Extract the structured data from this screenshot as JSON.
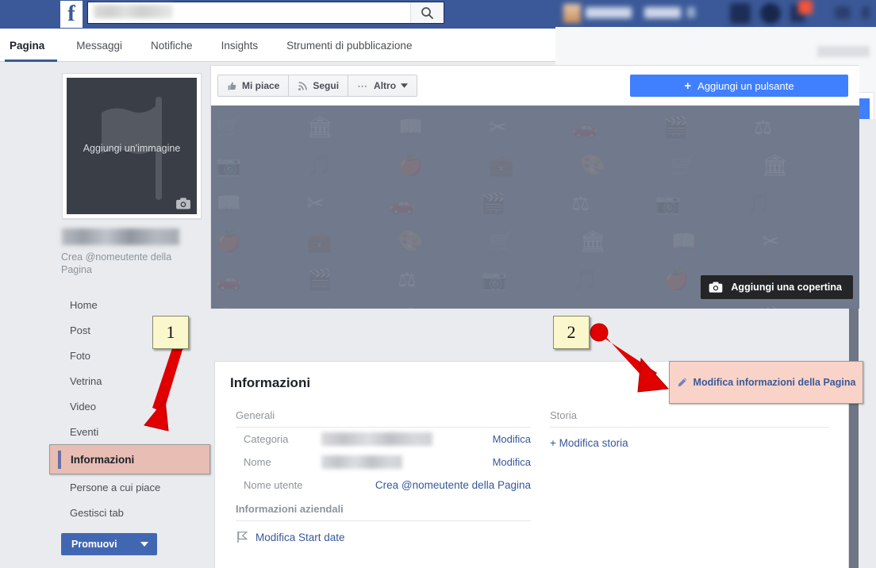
{
  "topbar": {
    "logo": "f",
    "search_placeholder": "",
    "search_value": "",
    "search_icon": "search-icon"
  },
  "tabs": [
    {
      "label": "Pagina",
      "active": true
    },
    {
      "label": "Messaggi",
      "active": false
    },
    {
      "label": "Notifiche",
      "active": false
    },
    {
      "label": "Insights",
      "active": false
    },
    {
      "label": "Strumenti di pubblicazione",
      "active": false
    }
  ],
  "action_bar": {
    "like_label": "Mi piace",
    "follow_label": "Segui",
    "more_label": "Altro",
    "add_button_label": "Aggiungi un pulsante",
    "add_button_plus": "+"
  },
  "cover": {
    "add_cover_label": "Aggiungi una copertina",
    "camera_icon": "camera-icon"
  },
  "profile_picture": {
    "placeholder_label": "Aggiungi un'immagine",
    "flag_icon": "flag-icon",
    "camera_icon": "camera-icon"
  },
  "sidebar": {
    "page_name": "",
    "username_prompt": "Crea @nomeutente della Pagina",
    "items": [
      {
        "label": "Home",
        "active": false
      },
      {
        "label": "Post",
        "active": false
      },
      {
        "label": "Foto",
        "active": false
      },
      {
        "label": "Vetrina",
        "active": false
      },
      {
        "label": "Video",
        "active": false
      },
      {
        "label": "Eventi",
        "active": false
      },
      {
        "label": "Informazioni",
        "active": true
      },
      {
        "label": "Persone a cui piace",
        "active": false
      },
      {
        "label": "Gestisci tab",
        "active": false
      }
    ],
    "promote_label": "Promuovi"
  },
  "info_card": {
    "title": "Informazioni",
    "edit_page_info_label": "Modifica informazioni della Pagina",
    "edit_page_info_icon": "pencil-icon",
    "general": {
      "heading": "Generali",
      "rows": [
        {
          "label": "Categoria",
          "value": "",
          "value_blurred": true,
          "action": "Modifica"
        },
        {
          "label": "Nome",
          "value": "",
          "value_blurred": true,
          "action": "Modifica"
        },
        {
          "label": "Nome utente",
          "value": "Crea @nomeutente della Pagina",
          "value_blurred": false,
          "action": ""
        }
      ]
    },
    "business": {
      "heading": "Informazioni aziendali",
      "start_date_label": "Modifica Start date",
      "flag_icon": "flag-icon"
    },
    "story": {
      "heading": "Storia",
      "edit_story_label": "+ Modifica storia"
    }
  },
  "annotations": [
    {
      "id": "1",
      "label": "1",
      "target": "sidebar-item-informazioni"
    },
    {
      "id": "2",
      "label": "2",
      "target": "edit-page-info-button"
    }
  ],
  "colors": {
    "facebook_blue": "#3b5998",
    "button_blue": "#4080ff",
    "highlight_pink": "#e8bdb4",
    "note_yellow": "#fbf7cd",
    "arrow_red": "#e00000",
    "link_blue": "#365899"
  }
}
